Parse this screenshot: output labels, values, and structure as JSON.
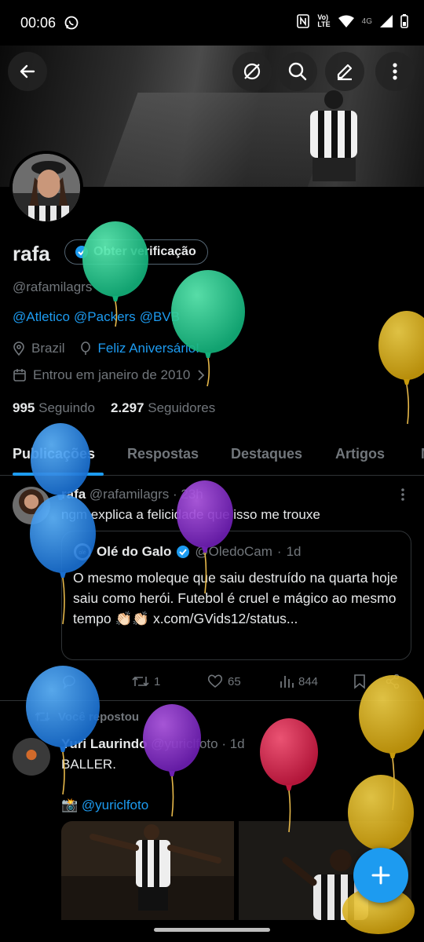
{
  "status_bar": {
    "time": "00:06"
  },
  "profile": {
    "name": "rafa",
    "verify_label": "Obter verificação",
    "handle": "@rafamilagrs",
    "bio_mentions": [
      "@Atletico",
      "@Packers",
      "@BVB"
    ],
    "location": "Brazil",
    "birthday_text": "Feliz Aniversário!",
    "joined": "Entrou em janeiro de 2010",
    "following_count": "995",
    "following_label": "Seguindo",
    "followers_count": "2.297",
    "followers_label": "Seguidores"
  },
  "tabs": [
    "Publicações",
    "Respostas",
    "Destaques",
    "Artigos"
  ],
  "post1": {
    "name": "rafa",
    "handle": "@rafamilagrs",
    "time": "23h",
    "text": "ngm explica a felicidade que isso me trouxe",
    "quote": {
      "name": "Olé do Galo",
      "handle": "@OledoCam",
      "time": "1d",
      "text": "O mesmo moleque que saiu destruído na quarta hoje saiu como herói. Futebol é cruel e mágico ao mesmo tempo 👏🏻👏🏻 x.com/GVids12/status..."
    },
    "actions": {
      "retweets": "1",
      "likes": "65",
      "views": "844"
    }
  },
  "post2": {
    "repost_label": "Você repostou",
    "name": "Yuri Laurindo",
    "handle": "@yuriclfoto",
    "time": "1d",
    "text": "BALLER.",
    "link_prefix": "📸",
    "link": "@yuriclfoto"
  },
  "icons": [
    "back-arrow-icon",
    "no-sync-icon",
    "search-icon",
    "edit-icon",
    "more-icon",
    "location-icon",
    "balloon-icon",
    "calendar-icon",
    "comment-icon",
    "retweet-icon",
    "heart-icon",
    "views-icon",
    "bookmark-icon",
    "share-icon",
    "plus-icon"
  ],
  "colors": {
    "accent": "#1d9bf0",
    "text": "#e7e9ea",
    "muted": "#71767b",
    "border": "#2f3336"
  }
}
